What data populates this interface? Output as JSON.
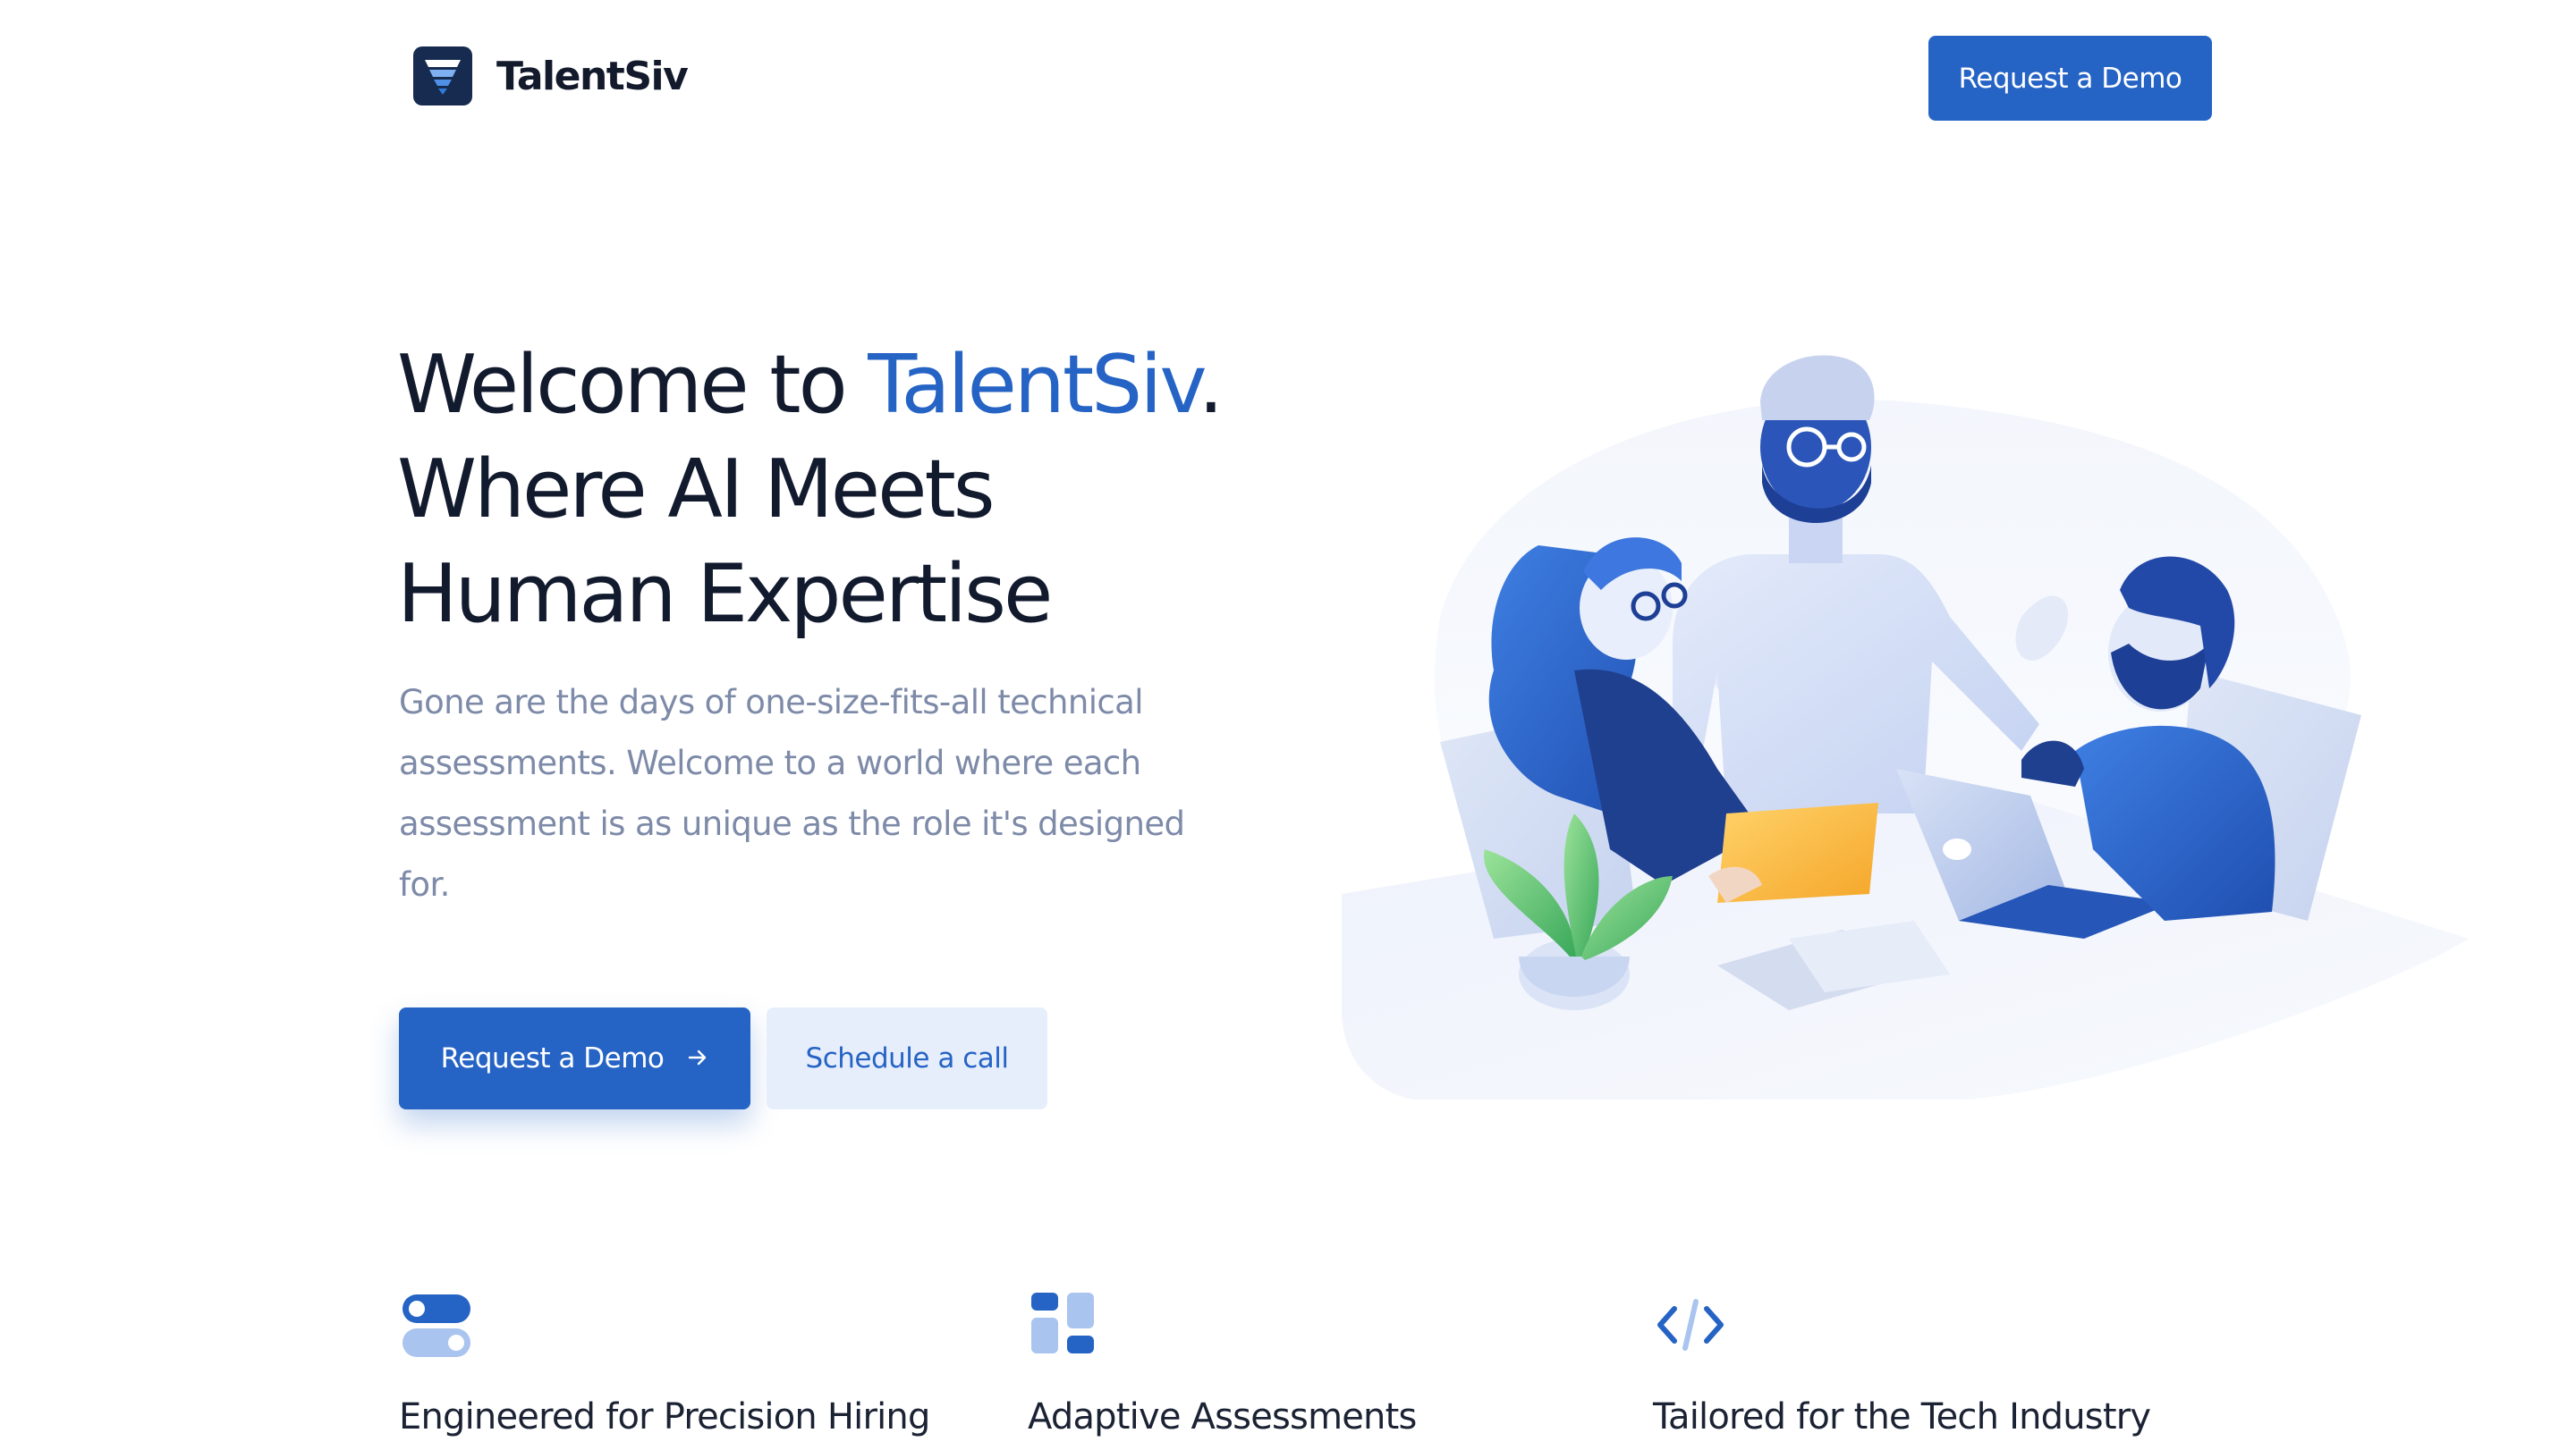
{
  "header": {
    "brand_name": "TalentSiv",
    "logo_icon": "funnel-logo-icon",
    "cta_label": "Request a Demo"
  },
  "hero": {
    "title_prefix": "Welcome to ",
    "title_brand": "TalentSiv",
    "title_period": ".",
    "title_line2": "Where AI Meets",
    "title_line3": "Human Expertise",
    "subtitle": "Gone are the days of one-size-fits-all technical assessments. Welcome to a world where each assessment is as unique as the role it's designed for.",
    "primary_cta": "Request a Demo",
    "primary_cta_icon": "arrow-right-icon",
    "secondary_cta": "Schedule a call",
    "illustration": "team-collaboration-illustration"
  },
  "features": [
    {
      "icon": "toggle-switches-icon",
      "title": "Engineered for Precision Hiring"
    },
    {
      "icon": "layout-blocks-icon",
      "title": "Adaptive Assessments"
    },
    {
      "icon": "code-brackets-icon",
      "title": "Tailored for the Tech Industry"
    }
  ],
  "colors": {
    "brand_blue": "#2563c5",
    "heading_dark": "#121a2e",
    "body_muted": "#7d8aa8",
    "secondary_button_bg": "#e6eefb",
    "logo_bg": "#162b4f"
  }
}
